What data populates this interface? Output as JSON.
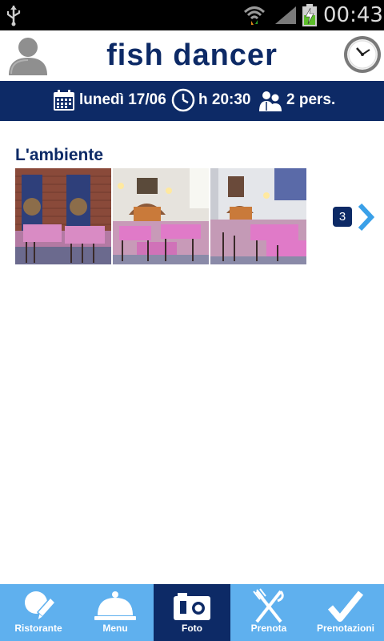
{
  "status_bar": {
    "time": "00:43"
  },
  "header": {
    "title": "fish dancer"
  },
  "info_bar": {
    "date": "lunedì 17/06",
    "time": "h 20:30",
    "people": "2 pers."
  },
  "gallery": {
    "title": "L'ambiente",
    "count": "3",
    "photos": [
      "restaurant-interior-photo",
      "restaurant-interior-photo",
      "restaurant-interior-photo"
    ]
  },
  "bottom_nav": {
    "tabs": [
      {
        "label": "Ristorante",
        "icon": "pen-nib-icon"
      },
      {
        "label": "Menu",
        "icon": "cloche-icon"
      },
      {
        "label": "Foto",
        "icon": "camera-icon",
        "active": true
      },
      {
        "label": "Prenota",
        "icon": "fork-knife-icon"
      },
      {
        "label": "Prenotazioni",
        "icon": "checkmark-icon"
      }
    ]
  },
  "colors": {
    "navy": "#0d2a66",
    "nav_blue": "#5fb0ee",
    "accent_blue": "#3aa0e8"
  }
}
